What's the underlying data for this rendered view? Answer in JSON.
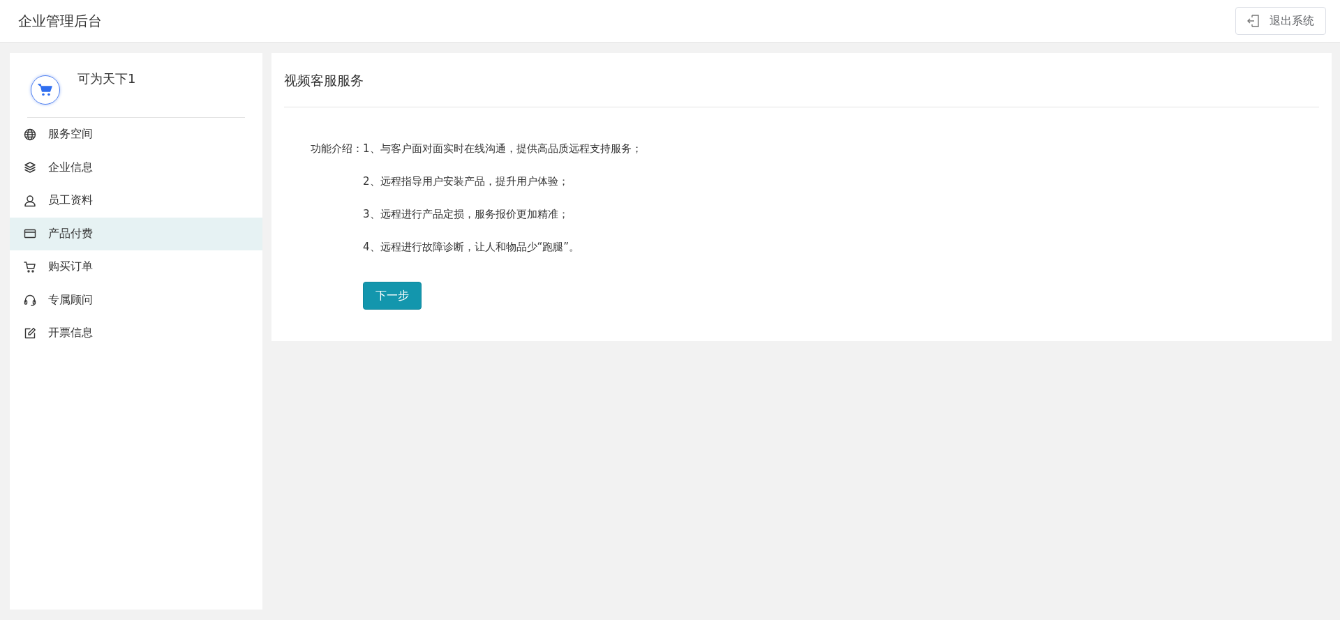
{
  "header": {
    "title": "企业管理后台",
    "logout_button": "退出系统"
  },
  "sidebar": {
    "account_name": "可为天下1",
    "items": [
      {
        "label": "服务空间",
        "selected": false
      },
      {
        "label": "企业信息",
        "selected": false
      },
      {
        "label": "员工资料",
        "selected": false
      },
      {
        "label": "产品付费",
        "selected": true
      },
      {
        "label": "购买订单",
        "selected": false
      },
      {
        "label": "专属顾问",
        "selected": false
      },
      {
        "label": "开票信息",
        "selected": false
      }
    ]
  },
  "panel": {
    "title": "视频客服服务",
    "intro_label": "功能介绍：",
    "features": [
      "1、与客户面对面实时在线沟通，提供高品质远程支持服务；",
      "2、远程指导用户安装产品，提升用户体验；",
      "3、远程进行产品定损，服务报价更加精准；",
      "4、远程进行故障诊断，让人和物品少“跑腿”。"
    ],
    "next_button": "下一步"
  }
}
